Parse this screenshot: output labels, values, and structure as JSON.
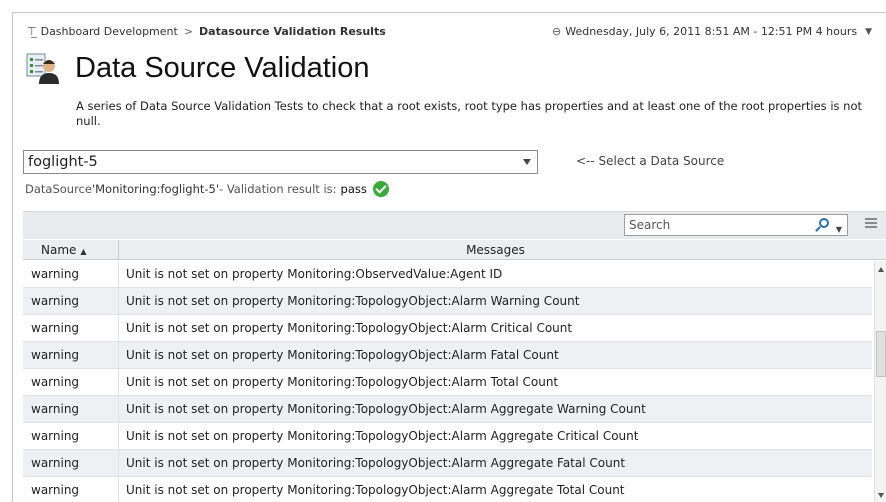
{
  "breadcrumb": {
    "parent": "Dashboard Development",
    "separator": ">",
    "current": "Datasource Validation Results"
  },
  "timerange": {
    "label": "Wednesday, July 6, 2011 8:51 AM - 12:51 PM 4 hours"
  },
  "page": {
    "title": "Data Source Validation",
    "description": "A series of Data Source Validation Tests to check that a root exists, root type has properties and at least one of the root properties is not null."
  },
  "datasource": {
    "selected": "foglight-5",
    "hint": "<-- Select a Data Source"
  },
  "status": {
    "prefix": "DataSource ",
    "name": "'Monitoring:foglight-5'",
    "middle": " - Validation result is:",
    "result": "pass"
  },
  "table": {
    "search_placeholder": "Search",
    "columns": {
      "name": "Name",
      "messages": "Messages"
    },
    "rows": [
      {
        "name": "warning",
        "message": "Unit is not set on property Monitoring:ObservedValue:Agent ID"
      },
      {
        "name": "warning",
        "message": "Unit is not set on property Monitoring:TopologyObject:Alarm Warning Count"
      },
      {
        "name": "warning",
        "message": "Unit is not set on property Monitoring:TopologyObject:Alarm Critical Count"
      },
      {
        "name": "warning",
        "message": "Unit is not set on property Monitoring:TopologyObject:Alarm Fatal Count"
      },
      {
        "name": "warning",
        "message": "Unit is not set on property Monitoring:TopologyObject:Alarm Total Count"
      },
      {
        "name": "warning",
        "message": "Unit is not set on property Monitoring:TopologyObject:Alarm Aggregate Warning Count"
      },
      {
        "name": "warning",
        "message": "Unit is not set on property Monitoring:TopologyObject:Alarm Aggregate Critical Count"
      },
      {
        "name": "warning",
        "message": "Unit is not set on property Monitoring:TopologyObject:Alarm Aggregate Fatal Count"
      },
      {
        "name": "warning",
        "message": "Unit is not set on property Monitoring:TopologyObject:Alarm Aggregate Total Count"
      }
    ]
  },
  "colors": {
    "pass": "#3aa83a",
    "accent": "#2a6db0"
  }
}
